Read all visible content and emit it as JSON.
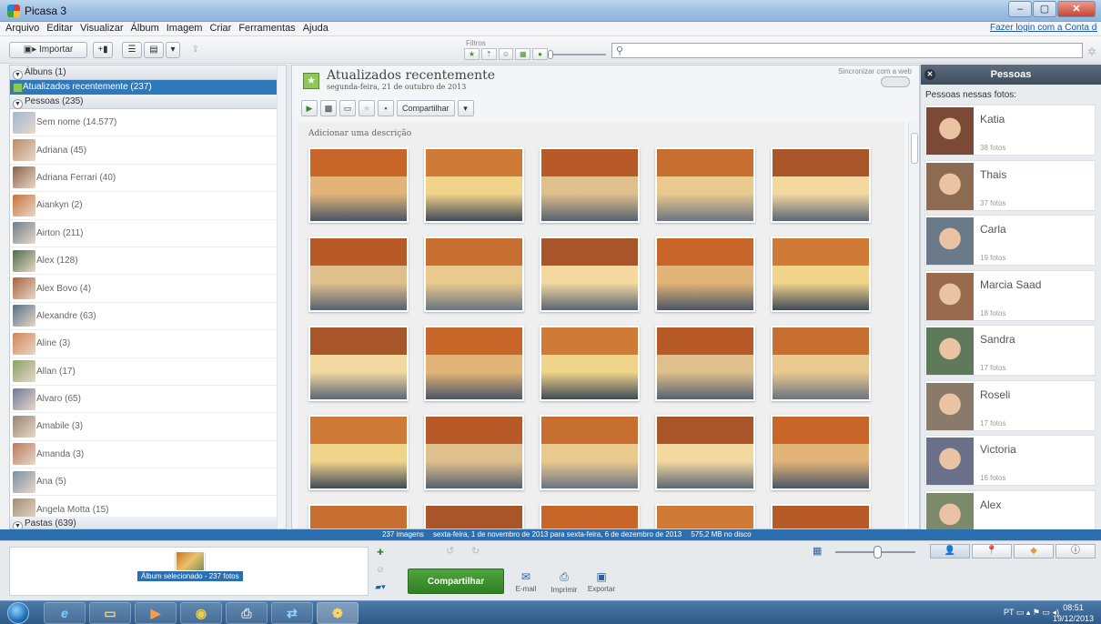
{
  "window": {
    "title": "Picasa 3",
    "minimize": "–",
    "maximize": "▢",
    "close": "✕"
  },
  "menu": {
    "items": [
      "Arquivo",
      "Editar",
      "Visualizar",
      "Álbum",
      "Imagem",
      "Criar",
      "Ferramentas",
      "Ajuda"
    ],
    "login_link": "Fazer login com a Conta do Googl"
  },
  "toolbar": {
    "import_label": "Importar",
    "filters_label": "Filtros",
    "search_placeholder": ""
  },
  "left_panel": {
    "albums_header": "Álbuns (1)",
    "selected_album": "Atualizados recentemente (237)",
    "people_header": "Pessoas (235)",
    "people": [
      {
        "name": "Sem nome (14.577)",
        "color": "#9fb7d6"
      },
      {
        "name": "Adriana (45)",
        "color": "#b88c6a"
      },
      {
        "name": "Adriana Ferrari (40)",
        "color": "#8b6248"
      },
      {
        "name": "Aiankyn (2)",
        "color": "#c7743a"
      },
      {
        "name": "Airton (211)",
        "color": "#6e7f8a"
      },
      {
        "name": "Alex (128)",
        "color": "#4b6f4a"
      },
      {
        "name": "Alex Bovo (4)",
        "color": "#a7623d"
      },
      {
        "name": "Alexandre (63)",
        "color": "#56708a"
      },
      {
        "name": "Aline (3)",
        "color": "#d08457"
      },
      {
        "name": "Allan (17)",
        "color": "#8aa068"
      },
      {
        "name": "Alvaro (65)",
        "color": "#6f7a9a"
      },
      {
        "name": "Amabile (3)",
        "color": "#9b8476"
      },
      {
        "name": "Amanda (3)",
        "color": "#b97a5d"
      },
      {
        "name": "Ana (5)",
        "color": "#7a8fa8"
      },
      {
        "name": "Angela Motta (15)",
        "color": "#a08d73"
      }
    ],
    "folders_header": "Pastas (639)"
  },
  "album": {
    "title": "Atualizados recentemente",
    "date": "segunda-feira, 21 de outubro de 2013",
    "sync_label": "Sincronizar com a web",
    "share_label": "Compartilhar",
    "description_placeholder": "Adicionar uma descrição"
  },
  "right_panel": {
    "title": "Pessoas",
    "subtitle": "Pessoas nessas fotos:",
    "people": [
      {
        "name": "Katia",
        "count": "38 fotos"
      },
      {
        "name": "Thais",
        "count": "37 fotos"
      },
      {
        "name": "Carla",
        "count": "19 fotos"
      },
      {
        "name": "Marcia Saad",
        "count": "18 fotos"
      },
      {
        "name": "Sandra",
        "count": "17 fotos"
      },
      {
        "name": "Roseli",
        "count": "17 fotos"
      },
      {
        "name": "Victoria",
        "count": "16 fotos"
      },
      {
        "name": "Alex",
        "count": ""
      }
    ]
  },
  "status": {
    "count": "237 imagens",
    "range": "sexta-feira, 1 de novembro de 2013 para sexta-feira, 6 de dezembro de 2013",
    "size": "575,2 MB no disco"
  },
  "bottom": {
    "tray_label": "Álbum selecionado - 237 fotos",
    "share_label": "Compartilhar",
    "email_label": "E-mail",
    "print_label": "Imprimir",
    "export_label": "Exportar"
  },
  "taskbar": {
    "lang": "PT",
    "time": "08:51",
    "date": "19/12/2013"
  }
}
